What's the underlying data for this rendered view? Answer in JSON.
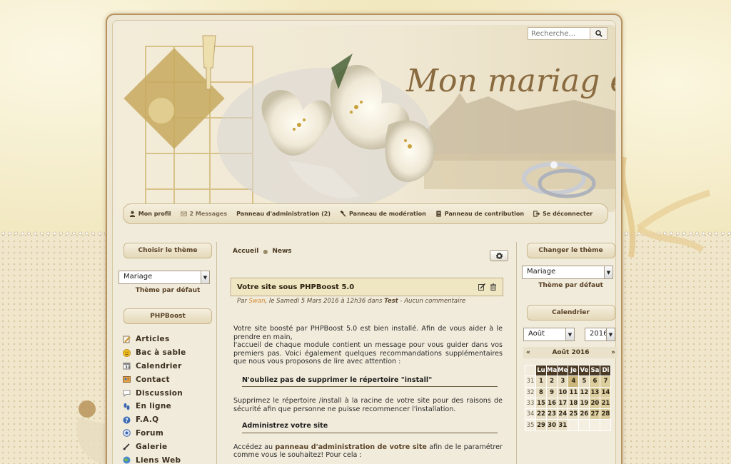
{
  "search": {
    "placeholder": "Recherche..."
  },
  "banner": {
    "title": "Mon mariag e"
  },
  "usermenu": {
    "items": [
      {
        "label": "Mon profil",
        "icon": "user-icon"
      },
      {
        "label": "2 Messages",
        "icon": "envelope-icon"
      },
      {
        "label": "Panneau d'administration (2)",
        "icon": ""
      },
      {
        "label": "Panneau de modération",
        "icon": "gavel-icon"
      },
      {
        "label": "Panneau de contribution",
        "icon": "document-icon"
      },
      {
        "label": "Se déconnecter",
        "icon": "logout-icon"
      }
    ]
  },
  "left": {
    "theme_title": "Choisir le thème",
    "theme_value": "Mariage",
    "theme_default": "Thème par défaut",
    "menu_title": "PHPBoost",
    "menu": [
      {
        "label": "Articles",
        "icon": "pencil-icon"
      },
      {
        "label": "Bac à sable",
        "icon": "smiley-icon"
      },
      {
        "label": "Calendrier",
        "icon": "calendar-icon"
      },
      {
        "label": "Contact",
        "icon": "contact-icon"
      },
      {
        "label": "Discussion",
        "icon": "chat-icon"
      },
      {
        "label": "En ligne",
        "icon": "footprints-icon"
      },
      {
        "label": "F.A.Q",
        "icon": "help-icon"
      },
      {
        "label": "Forum",
        "icon": "forum-icon"
      },
      {
        "label": "Galerie",
        "icon": "brush-icon"
      },
      {
        "label": "Liens Web",
        "icon": "globe-icon"
      }
    ]
  },
  "center": {
    "breadcrumb": [
      "Accueil",
      "News"
    ],
    "article": {
      "title": "Votre site sous PHPBoost 5.0",
      "meta_prefix": "Par ",
      "author": "Swan",
      "meta_date": ", le Samedi 5 Mars 2016 à 12h36 dans ",
      "category": "Test",
      "meta_suffix": " - Aucun commentaire",
      "p1": "Votre site boosté par PHPBoost 5.0 est bien installé. Afin de vous aider à le prendre en main,",
      "p1b": "l'accueil de chaque module contient un message pour vous guider dans vos premiers pas. Voici également quelques recommandations supplémentaires que nous vous proposons de lire avec attention :",
      "h1": "N'oubliez pas de supprimer le répertoire \"install\"",
      "p2": "Supprimez le répertoire /install à la racine de votre site pour des raisons de sécurité afin que personne ne puisse recommencer l'installation.",
      "h2": "Administrez votre site",
      "p3a": "Accédez au ",
      "p3link": "panneau d'administration de votre site",
      "p3b": " afin de le paramétrer comme vous le souhaitez! Pour cela :"
    }
  },
  "right": {
    "theme_title": "Changer le thème",
    "theme_value": "Mariage",
    "theme_default": "Thème par défaut",
    "cal_title": "Calendrier",
    "month_select": "Août",
    "year_select": "2016",
    "month_label": "Août 2016",
    "prev": "«",
    "next": "»",
    "days": [
      "Lu",
      "Ma",
      "Me",
      "Je",
      "Ve",
      "Sa",
      "Di"
    ],
    "weeks": [
      {
        "wk": "31",
        "d": [
          "1",
          "2",
          "3",
          "4",
          "5",
          "6",
          "7"
        ]
      },
      {
        "wk": "32",
        "d": [
          "8",
          "9",
          "10",
          "11",
          "12",
          "13",
          "14"
        ]
      },
      {
        "wk": "33",
        "d": [
          "15",
          "16",
          "17",
          "18",
          "19",
          "20",
          "21"
        ]
      },
      {
        "wk": "34",
        "d": [
          "22",
          "23",
          "24",
          "25",
          "26",
          "27",
          "28"
        ]
      },
      {
        "wk": "35",
        "d": [
          "29",
          "30",
          "31",
          "",
          "",
          "",
          ""
        ]
      }
    ]
  }
}
